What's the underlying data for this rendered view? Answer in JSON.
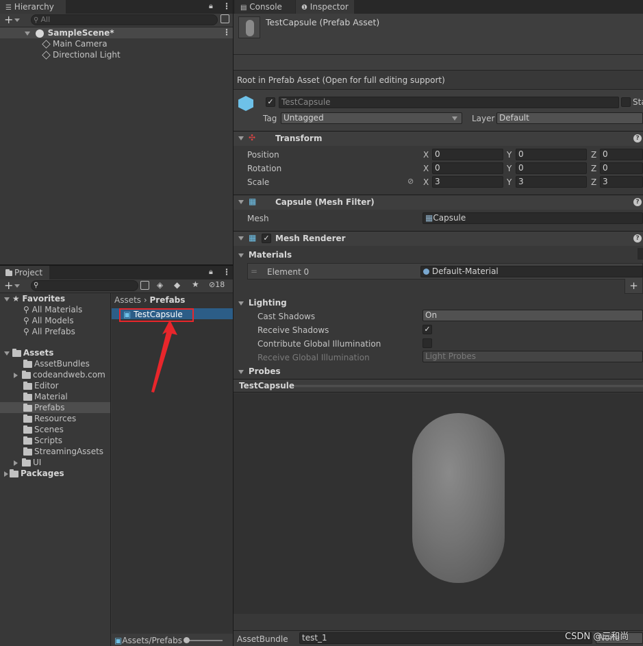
{
  "hierarchy": {
    "tab_label": "Hierarchy",
    "search_placeholder": "All",
    "scene": "SampleScene*",
    "items": [
      "Main Camera",
      "Directional Light"
    ]
  },
  "project": {
    "tab_label": "Project",
    "hidden_count": "18",
    "favorites_label": "Favorites",
    "favorites": [
      "All Materials",
      "All Models",
      "All Prefabs"
    ],
    "assets_label": "Assets",
    "folders": [
      "AssetBundles",
      "codeandweb.com",
      "Editor",
      "Material",
      "Prefabs",
      "Resources",
      "Scenes",
      "Scripts",
      "StreamingAssets",
      "UI"
    ],
    "packages_label": "Packages",
    "breadcrumb": [
      "Assets",
      "Prefabs"
    ],
    "selected_asset": "TestCapsule",
    "footer_path": "Assets/Prefabs"
  },
  "inspector": {
    "console_tab": "Console",
    "inspector_tab": "Inspector",
    "title": "TestCapsule (Prefab Asset)",
    "root_note": "Root in Prefab Asset (Open for full editing support)",
    "object_name": "TestCapsule",
    "static_label": "Sta",
    "tag_label": "Tag",
    "tag_value": "Untagged",
    "layer_label": "Layer",
    "layer_value": "Default",
    "transform": {
      "header": "Transform",
      "position_label": "Position",
      "rotation_label": "Rotation",
      "scale_label": "Scale",
      "position": [
        "0",
        "0",
        "0"
      ],
      "rotation": [
        "0",
        "0",
        "0"
      ],
      "scale": [
        "3",
        "3",
        "3"
      ]
    },
    "mesh_filter": {
      "header": "Capsule (Mesh Filter)",
      "mesh_label": "Mesh",
      "mesh_value": "Capsule"
    },
    "mesh_renderer": {
      "header": "Mesh Renderer",
      "materials_label": "Materials",
      "element_label": "Element 0",
      "element_value": "Default-Material",
      "lighting_label": "Lighting",
      "cast_shadows_label": "Cast Shadows",
      "cast_shadows_value": "On",
      "receive_shadows_label": "Receive Shadows",
      "contribute_gi_label": "Contribute Global Illumination",
      "receive_gi_label": "Receive Global Illumination",
      "receive_gi_value": "Light Probes",
      "probes_label": "Probes"
    },
    "preview_title": "TestCapsule",
    "assetbundle_label": "AssetBundle",
    "assetbundle_value": "test_1",
    "assetbundle_variant": "None"
  },
  "watermark": "CSDN @三和尚",
  "colors": {
    "selection": "#2c5d87",
    "annotation": "#e8262b",
    "panel": "#383838"
  }
}
